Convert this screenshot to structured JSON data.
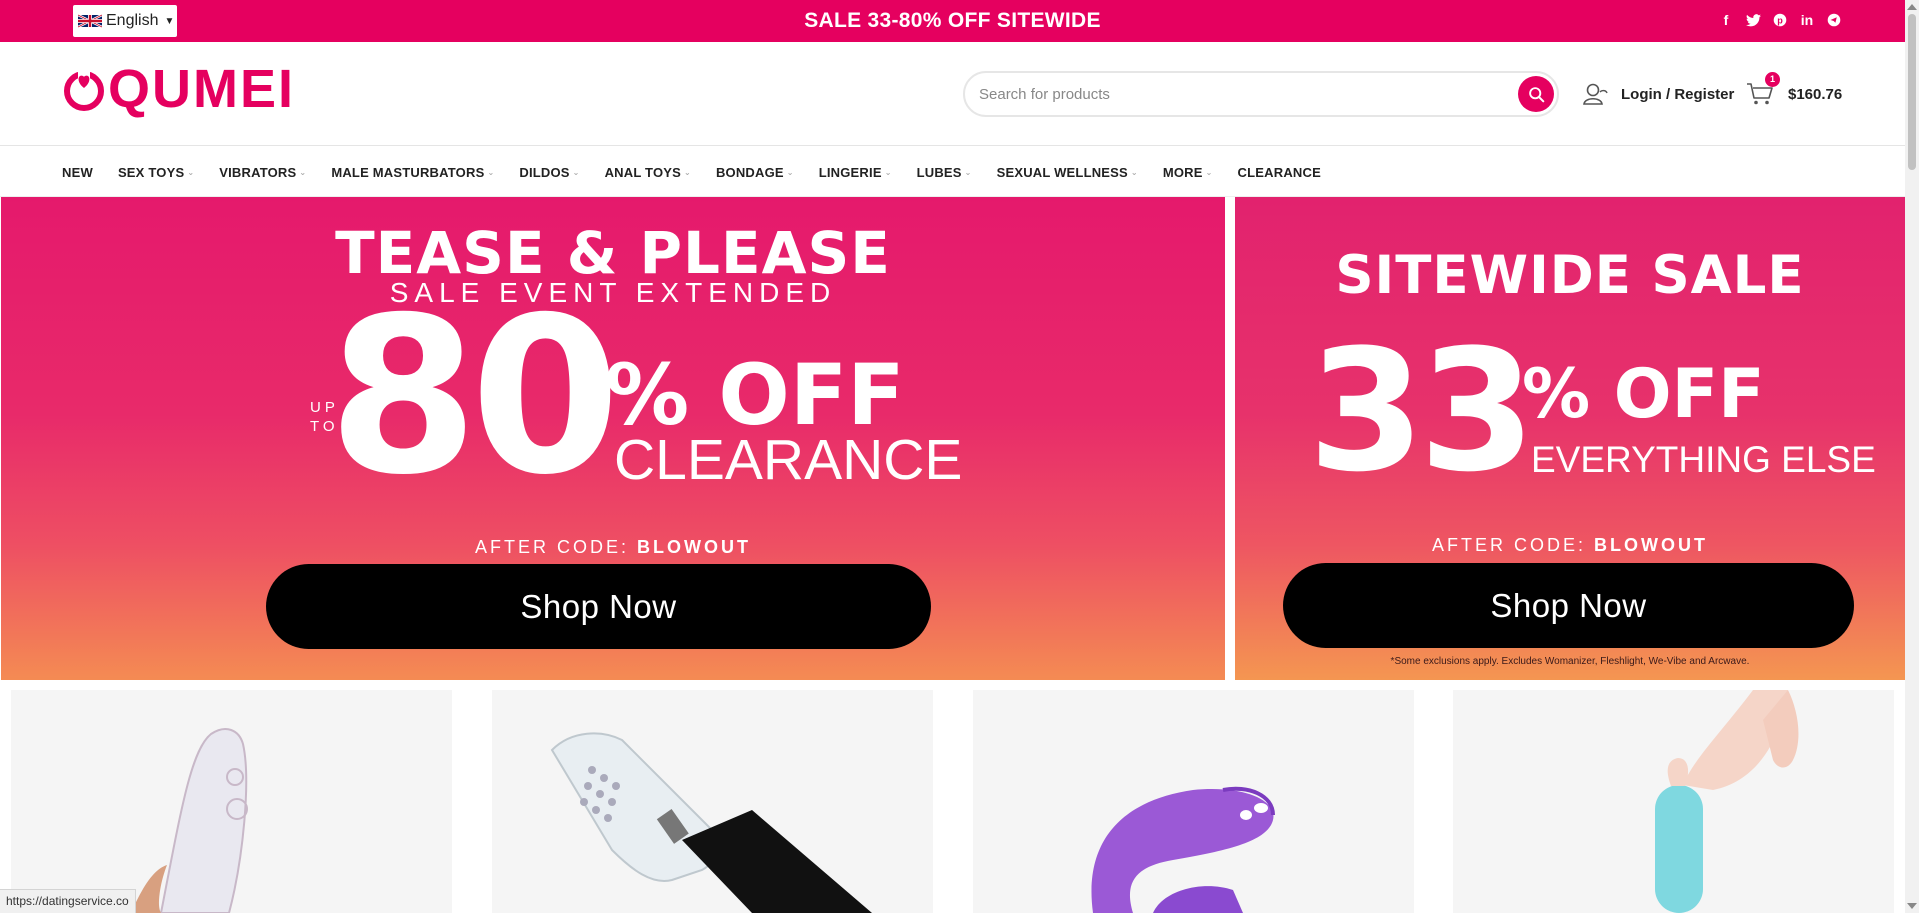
{
  "topbar": {
    "language": "English",
    "promo_text": "SALE 33-80% OFF SITEWIDE",
    "social_icons": [
      "facebook-icon",
      "twitter-icon",
      "pinterest-icon",
      "linkedin-icon",
      "telegram-icon"
    ]
  },
  "header": {
    "logo_text": "QUMEI",
    "search_placeholder": "Search for products",
    "account_label": "Login / Register",
    "cart_count": "1",
    "cart_total": "$160.76"
  },
  "nav": {
    "items": [
      {
        "label": "NEW",
        "dropdown": false
      },
      {
        "label": "SEX TOYS",
        "dropdown": true
      },
      {
        "label": "VIBRATORS",
        "dropdown": true
      },
      {
        "label": "MALE MASTURBATORS",
        "dropdown": true
      },
      {
        "label": "DILDOS",
        "dropdown": true
      },
      {
        "label": "ANAL TOYS",
        "dropdown": true
      },
      {
        "label": "BONDAGE",
        "dropdown": true
      },
      {
        "label": "LINGERIE",
        "dropdown": true
      },
      {
        "label": "LUBES",
        "dropdown": true
      },
      {
        "label": "SEXUAL WELLNESS",
        "dropdown": true
      },
      {
        "label": "MORE",
        "dropdown": true
      },
      {
        "label": "CLEARANCE",
        "dropdown": false
      }
    ]
  },
  "banners": {
    "left": {
      "headline": "TEASE & PLEASE",
      "subhead": "SALE EVENT EXTENDED",
      "up": "UP",
      "to": "TO",
      "percent": "80",
      "off": "% OFF",
      "what": "CLEARANCE",
      "code_prefix": "AFTER CODE:",
      "code": "BLOWOUT",
      "cta": "Shop Now"
    },
    "right": {
      "headline": "SITEWIDE SALE",
      "percent": "33",
      "off": "% OFF",
      "what": "EVERYTHING ELSE",
      "code_prefix": "AFTER CODE:",
      "code": "BLOWOUT",
      "cta": "Shop Now",
      "note": "*Some exclusions apply. Excludes Womanizer, Fleshlight, We-Vibe and Arcwave."
    }
  },
  "status_url": "https://datingservice.co",
  "colors": {
    "brand": "#e5005f",
    "banner_pink": "#e5196c",
    "banner_orange": "#f48b53",
    "cta": "#000000"
  }
}
